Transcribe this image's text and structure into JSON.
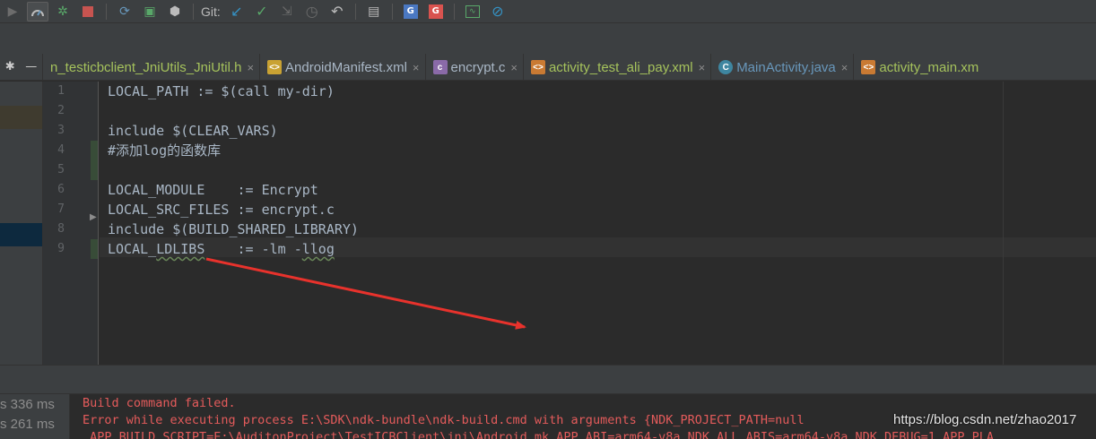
{
  "toolbar": {
    "git_label": "Git:"
  },
  "tabs": [
    {
      "label": "n_testicbclient_JniUtils_JniUtil.h",
      "color": "#a5c25c",
      "icon": "h-file-icon",
      "close": "×"
    },
    {
      "label": "AndroidManifest.xml",
      "color": "#a9b7c6",
      "icon": "xml-file-icon",
      "close": "×"
    },
    {
      "label": "encrypt.c",
      "color": "#a9b7c6",
      "icon": "c-file-icon",
      "close": "×"
    },
    {
      "label": "activity_test_ali_pay.xml",
      "color": "#a5c25c",
      "icon": "layout-file-icon",
      "close": "×"
    },
    {
      "label": "MainActivity.java",
      "color": "#6897bb",
      "icon": "java-class-icon",
      "close": "×"
    },
    {
      "label": "activity_main.xm",
      "color": "#a5c25c",
      "icon": "layout-file-icon",
      "close": ""
    }
  ],
  "editor": {
    "line_numbers": [
      "1",
      "2",
      "3",
      "4",
      "5",
      "6",
      "7",
      "8",
      "9"
    ],
    "lines": [
      "LOCAL_PATH := $(call my-dir)",
      "",
      "include $(CLEAR_VARS)",
      "#添加log的函数库",
      "",
      "LOCAL_MODULE    := Encrypt",
      "LOCAL_SRC_FILES := encrypt.c",
      "include $(BUILD_SHARED_LIBRARY)",
      "LOCAL_LDLIBS    := -lm -llog"
    ]
  },
  "build": {
    "times": [
      "s 336 ms",
      "s 261 ms"
    ],
    "output": [
      "Build command failed.",
      "Error while executing process E:\\SDK\\ndk-bundle\\ndk-build.cmd with arguments {NDK_PROJECT_PATH=null",
      " APP_BUILD_SCRIPT=E:\\AuditonProject\\TestICBClient\\jni\\Android.mk APP_ABI=arm64-v8a NDK_ALL_ABIS=arm64-v8a NDK_DEBUG=1 APP_PLA"
    ]
  },
  "watermark": "https://blog.csdn.net/zhao2017",
  "colors": {
    "error": "#e45b5b",
    "arrow": "#e8322c"
  }
}
